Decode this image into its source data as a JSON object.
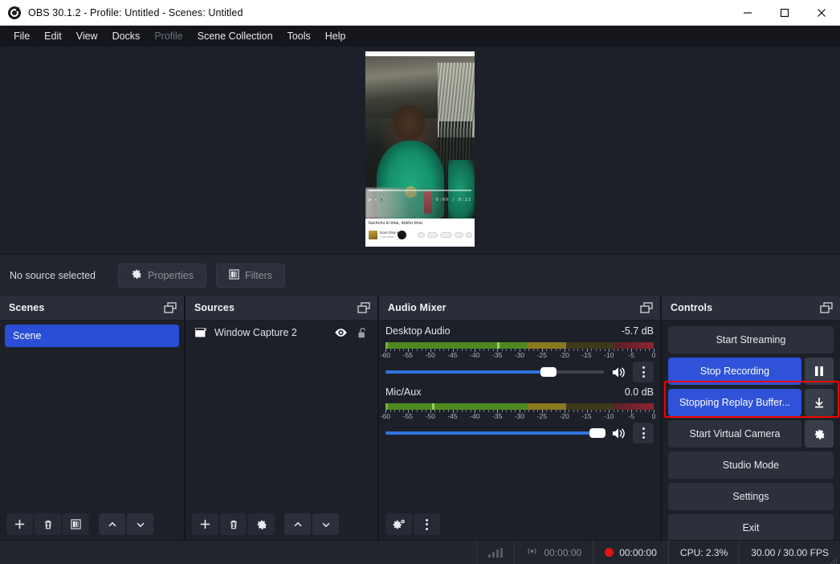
{
  "window": {
    "title": "OBS 30.1.2 - Profile: Untitled - Scenes: Untitled",
    "minimize_label": "Minimize",
    "maximize_label": "Maximize",
    "close_label": "Close"
  },
  "menu": {
    "items": [
      {
        "label": "File",
        "disabled": false
      },
      {
        "label": "Edit",
        "disabled": false
      },
      {
        "label": "View",
        "disabled": false
      },
      {
        "label": "Docks",
        "disabled": false
      },
      {
        "label": "Profile",
        "disabled": true
      },
      {
        "label": "Scene Collection",
        "disabled": false
      },
      {
        "label": "Tools",
        "disabled": false
      },
      {
        "label": "Help",
        "disabled": false
      }
    ]
  },
  "preview": {
    "video_title": "bachchu ki bhai, dekho bhai",
    "channel_name": "Dost Ghar Ka",
    "channel_sub": "1.2K views",
    "timecode": "0:09 / 0:23",
    "action_pills": [
      "Like",
      "Share",
      "Download",
      "Clip",
      "Save"
    ]
  },
  "source_toolbar": {
    "status": "No source selected",
    "properties_label": "Properties",
    "filters_label": "Filters"
  },
  "scenes": {
    "title": "Scenes",
    "items": [
      {
        "label": "Scene",
        "selected": true
      }
    ],
    "toolbar": [
      "add-scene",
      "remove-scene",
      "scene-filters",
      "move-scene-up",
      "move-scene-down"
    ]
  },
  "sources": {
    "title": "Sources",
    "items": [
      {
        "label": "Window Capture 2",
        "visible": true,
        "locked": false
      }
    ],
    "toolbar": [
      "add-source",
      "remove-source",
      "source-properties",
      "move-source-up",
      "move-source-down"
    ]
  },
  "mixer": {
    "title": "Audio Mixer",
    "tick_labels": [
      "-60",
      "-55",
      "-50",
      "-45",
      "-40",
      "-35",
      "-30",
      "-25",
      "-20",
      "-15",
      "-10",
      "-5",
      "0"
    ],
    "tracks": [
      {
        "name": "Desktop Audio",
        "db": "-5.7 dB",
        "meter_level_pct": 67.5,
        "meter_peak_pct": 41.5,
        "volume_pct": 74.5,
        "muted": false
      },
      {
        "name": "Mic/Aux",
        "db": "0.0 dB",
        "meter_level_pct": 67.5,
        "meter_peak_pct": 17.5,
        "volume_pct": 97.0,
        "muted": false
      }
    ],
    "toolbar": [
      "advanced-audio-properties",
      "mixer-menu"
    ]
  },
  "controls": {
    "title": "Controls",
    "start_streaming_label": "Start Streaming",
    "stop_recording_label": "Stop Recording",
    "pause_recording_label": "Pause Recording",
    "replay_buffer_label": "Stopping Replay Buffer...",
    "save_replay_label": "Save Replay",
    "start_virtual_camera_label": "Start Virtual Camera",
    "virtual_camera_config_label": "Virtual Camera Settings",
    "studio_mode_label": "Studio Mode",
    "settings_label": "Settings",
    "exit_label": "Exit",
    "highlight_color": "#f50000"
  },
  "status": {
    "stream_time": "00:00:00",
    "record_time": "00:00:00",
    "cpu": "CPU: 2.3%",
    "fps": "30.00 / 30.00 FPS"
  }
}
